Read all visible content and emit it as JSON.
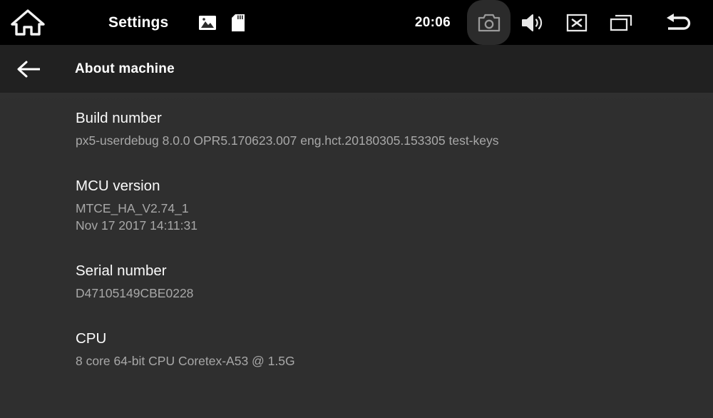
{
  "status_bar": {
    "home_icon": "home-icon",
    "app_title": "Settings",
    "image_icon": "image-icon",
    "sdcard_icon": "sdcard-icon",
    "clock": "20:06",
    "screenshot_icon": "camera-icon",
    "volume_icon": "volume-icon",
    "close_icon": "close-box-icon",
    "recents_icon": "recents-icon",
    "back_icon": "back-arrow-icon",
    "highlight_color": "#2b2b2b",
    "background_color": "#000000"
  },
  "sub_header": {
    "back_icon": "arrow-left-icon",
    "title": "About machine",
    "background_color": "#212121"
  },
  "content": {
    "background_color": "#2f2f2f",
    "items": [
      {
        "title": "Build number",
        "value": "px5-userdebug 8.0.0 OPR5.170623.007 eng.hct.20180305.153305 test-keys"
      },
      {
        "title": "MCU version",
        "value": "MTCE_HA_V2.74_1",
        "value2": "Nov 17 2017 14:11:31"
      },
      {
        "title": "Serial number",
        "value": "D47105149CBE0228"
      },
      {
        "title": "CPU",
        "value": "8 core 64-bit CPU Coretex-A53 @ 1.5G"
      }
    ]
  }
}
